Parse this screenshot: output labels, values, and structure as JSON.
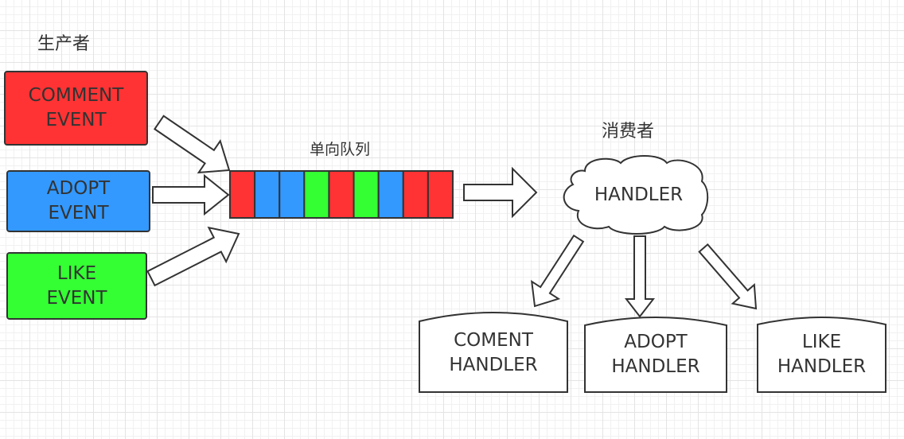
{
  "producers_title": "生产者",
  "queue_title": "单向队列",
  "consumers_title": "消费者",
  "producers": [
    {
      "line1": "COMMENT",
      "line2": "EVENT",
      "color": "#ff3333"
    },
    {
      "line1": "ADOPT",
      "line2": "EVENT",
      "color": "#3399ff"
    },
    {
      "line1": "LIKE",
      "line2": "EVENT",
      "color": "#33ff33"
    }
  ],
  "queue_cells": [
    "#ff3333",
    "#3399ff",
    "#3399ff",
    "#33ff33",
    "#ff3333",
    "#33ff33",
    "#3399ff",
    "#ff3333",
    "#ff3333"
  ],
  "dispatcher": "HANDLER",
  "handlers": [
    {
      "line1": "COMENT",
      "line2": "HANDLER"
    },
    {
      "line1": "ADOPT",
      "line2": "HANDLER"
    },
    {
      "line1": "LIKE",
      "line2": "HANDLER"
    }
  ]
}
